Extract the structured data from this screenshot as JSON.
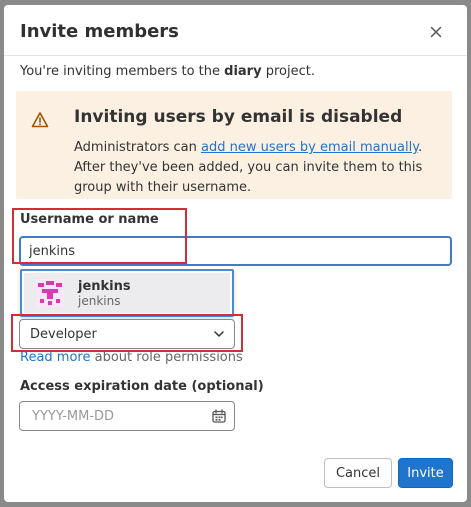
{
  "modal": {
    "title": "Invite members",
    "intro_prefix": "You're inviting members to the ",
    "project_name": "diary",
    "intro_suffix": " project."
  },
  "alert": {
    "title": "Inviting users by email is disabled",
    "body_prefix": "Administrators can ",
    "link_text": "add new users by email manually",
    "body_suffix": ". After they've been added, you can invite them to this group with their username.",
    "icon": "warning-icon",
    "background_color": "#fcf0e2"
  },
  "username": {
    "label": "Username or name",
    "value": "jenkins"
  },
  "suggestion": {
    "name": "jenkins",
    "username": "jenkins",
    "avatar_color": "#d53cb2"
  },
  "role": {
    "selected": "Developer",
    "help_link": "Read more",
    "help_suffix": " about role permissions"
  },
  "expiration": {
    "label": "Access expiration date (optional)",
    "placeholder": "YYYY-MM-DD"
  },
  "buttons": {
    "cancel": "Cancel",
    "invite": "Invite"
  },
  "colors": {
    "primary": "#1f75cb",
    "highlight_box": "#d62b3a"
  }
}
